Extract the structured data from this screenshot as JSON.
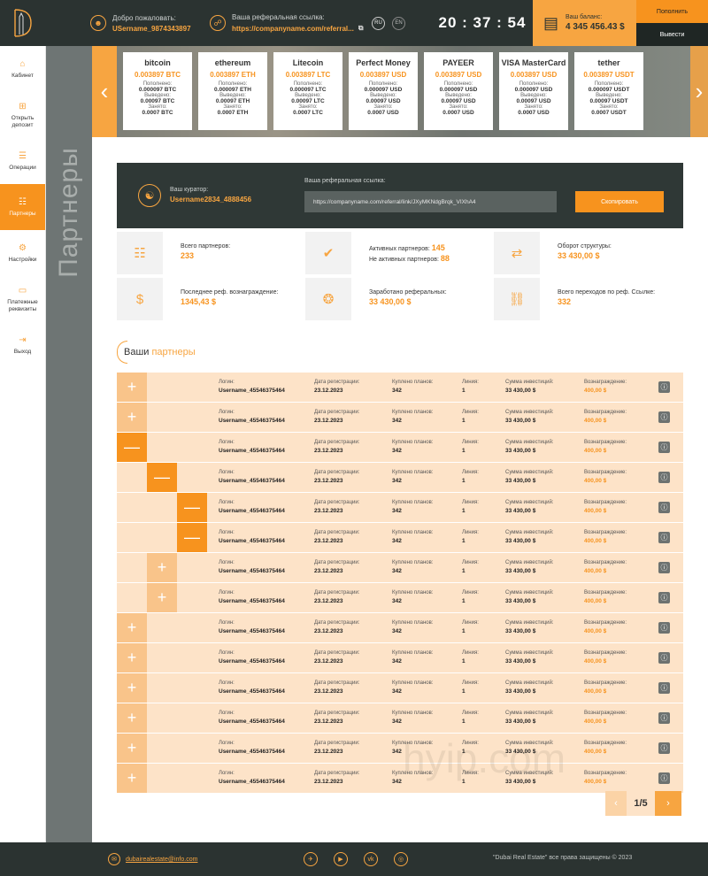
{
  "header": {
    "welcome_label": "Добро пожаловать:",
    "username": "USername_9874343897",
    "ref_label": "Ваша реферальная ссылка:",
    "ref_short": "https://companyname.com/referral...",
    "lang_ru": "RU",
    "lang_en": "EN",
    "clock": "20 : 37 : 54",
    "balance_label": "Ваш баланс:",
    "balance_value": "4 345 456.43 $",
    "deposit_button": "Пополнить",
    "withdraw_button": "Вывести"
  },
  "sidebar": [
    {
      "label": "Кабинет",
      "icon": "home-icon",
      "glyph": "⌂"
    },
    {
      "label": "Открыть депозит",
      "icon": "deposit-icon",
      "glyph": "⊞"
    },
    {
      "label": "Операции",
      "icon": "list-icon",
      "glyph": "☰"
    },
    {
      "label": "Партнеры",
      "icon": "partners-icon",
      "glyph": "☷",
      "active": true
    },
    {
      "label": "Настройки",
      "icon": "gear-icon",
      "glyph": "⚙"
    },
    {
      "label": "Платежные реквизиты",
      "icon": "wallet-icon",
      "glyph": "▭"
    },
    {
      "label": "Выход",
      "icon": "logout-icon",
      "glyph": "⇥"
    }
  ],
  "page_vertical_title": "Партнеры",
  "ticker": {
    "labels": {
      "replenished": "Пополнено:",
      "withdrawn": "Выведено:",
      "borrowed": "Занято:"
    },
    "coins": [
      {
        "name": "bitcoin",
        "rate": "0.003897 BTC",
        "replenished": "0.000097 BTC",
        "withdrawn": "0.00097 BTC",
        "borrowed": "0.0007 BTC"
      },
      {
        "name": "ethereum",
        "rate": "0.003897 ETH",
        "replenished": "0.000097 ETH",
        "withdrawn": "0.00097 ETH",
        "borrowed": "0.0007 ETH"
      },
      {
        "name": "Litecoin",
        "rate": "0.003897 LTC",
        "replenished": "0.000097 LTC",
        "withdrawn": "0.00097 LTC",
        "borrowed": "0.0007 LTC"
      },
      {
        "name": "Perfect Money",
        "rate": "0.003897 USD",
        "replenished": "0.000097 USD",
        "withdrawn": "0.00097 USD",
        "borrowed": "0.0007 USD"
      },
      {
        "name": "PAYEER",
        "rate": "0.003897 USD",
        "replenished": "0.000097 USD",
        "withdrawn": "0.00097 USD",
        "borrowed": "0.0007 USD"
      },
      {
        "name": "VISA MasterCard",
        "rate": "0.003897 USD",
        "replenished": "0.000097 USD",
        "withdrawn": "0.00097 USD",
        "borrowed": "0.0007 USD"
      },
      {
        "name": "tether",
        "rate": "0.003897 USDT",
        "replenished": "0.000097 USDT",
        "withdrawn": "0.00097 USDT",
        "borrowed": "0.0007 USDT"
      }
    ]
  },
  "referral": {
    "curator_label": "Ваш куратор:",
    "curator_value": "Username2834_4888456",
    "link_label": "Ваша реферальная ссылка:",
    "link_value": "https://companyname.com/referral/link/JXyMKNdgBrqk_VIXhA4",
    "copy_button": "Скопировать"
  },
  "stats": [
    {
      "label": "Всего партнеров:",
      "value": "233",
      "icon": "users-icon",
      "glyph": "☷"
    },
    {
      "label": "Активных партнеров:",
      "value": "145",
      "label2": "Не активных партнеров:",
      "value2": "88",
      "icon": "user-check-icon",
      "glyph": "✔"
    },
    {
      "label": "Оборот структуры:",
      "value": "33 430,00 $",
      "icon": "exchange-icon",
      "glyph": "⇄"
    },
    {
      "label": "Последнее реф. вознаграждение:",
      "value": "1345,43 $",
      "icon": "money-hand-icon",
      "glyph": "$"
    },
    {
      "label": "Заработано реферальных:",
      "value": "33 430,00 $",
      "icon": "coins-icon",
      "glyph": "❂"
    },
    {
      "label": "Всего переходов по реф. Ссылке:",
      "value": "332",
      "icon": "link-icon",
      "glyph": "⛓"
    }
  ],
  "partners": {
    "title_plain": "Ваши",
    "title_highlight": "партнеры",
    "headers": {
      "login": "Логин:",
      "date": "Дата регистрации:",
      "plans": "Куплено планов:",
      "line": "Линия:",
      "invest": "Сумма инвестиций:",
      "reward": "Вознаграждение:"
    },
    "rows": [
      {
        "level": 0,
        "state": "plus",
        "login": "Username_45546375464",
        "date": "23.12.2023",
        "plans": "342",
        "line": "1",
        "invest": "33 430,00 $",
        "reward": "400,00 $"
      },
      {
        "level": 0,
        "state": "plus",
        "login": "Username_45546375464",
        "date": "23.12.2023",
        "plans": "342",
        "line": "1",
        "invest": "33 430,00 $",
        "reward": "400,00 $"
      },
      {
        "level": 0,
        "state": "minus",
        "login": "Username_45546375464",
        "date": "23.12.2023",
        "plans": "342",
        "line": "1",
        "invest": "33 430,00 $",
        "reward": "400,00 $"
      },
      {
        "level": 1,
        "state": "minus",
        "login": "Username_45546375464",
        "date": "23.12.2023",
        "plans": "342",
        "line": "1",
        "invest": "33 430,00 $",
        "reward": "400,00 $"
      },
      {
        "level": 2,
        "state": "minus",
        "login": "Username_45546375464",
        "date": "23.12.2023",
        "plans": "342",
        "line": "1",
        "invest": "33 430,00 $",
        "reward": "400,00 $"
      },
      {
        "level": 2,
        "state": "minus",
        "login": "Username_45546375464",
        "date": "23.12.2023",
        "plans": "342",
        "line": "1",
        "invest": "33 430,00 $",
        "reward": "400,00 $"
      },
      {
        "level": 1,
        "state": "plus",
        "login": "Username_45546375464",
        "date": "23.12.2023",
        "plans": "342",
        "line": "1",
        "invest": "33 430,00 $",
        "reward": "400,00 $"
      },
      {
        "level": 1,
        "state": "plus",
        "login": "Username_45546375464",
        "date": "23.12.2023",
        "plans": "342",
        "line": "1",
        "invest": "33 430,00 $",
        "reward": "400,00 $"
      },
      {
        "level": 0,
        "state": "plus",
        "login": "Username_45546375464",
        "date": "23.12.2023",
        "plans": "342",
        "line": "1",
        "invest": "33 430,00 $",
        "reward": "400,00 $"
      },
      {
        "level": 0,
        "state": "plus",
        "login": "Username_45546375464",
        "date": "23.12.2023",
        "plans": "342",
        "line": "1",
        "invest": "33 430,00 $",
        "reward": "400,00 $"
      },
      {
        "level": 0,
        "state": "plus",
        "login": "Username_45546375464",
        "date": "23.12.2023",
        "plans": "342",
        "line": "1",
        "invest": "33 430,00 $",
        "reward": "400,00 $"
      },
      {
        "level": 0,
        "state": "plus",
        "login": "Username_45546375464",
        "date": "23.12.2023",
        "plans": "342",
        "line": "1",
        "invest": "33 430,00 $",
        "reward": "400,00 $"
      },
      {
        "level": 0,
        "state": "plus",
        "login": "Username_45546375464",
        "date": "23.12.2023",
        "plans": "342",
        "line": "1",
        "invest": "33 430,00 $",
        "reward": "400,00 $"
      },
      {
        "level": 0,
        "state": "plus",
        "login": "Username_45546375464",
        "date": "23.12.2023",
        "plans": "342",
        "line": "1",
        "invest": "33 430,00 $",
        "reward": "400,00 $"
      }
    ]
  },
  "pagination": {
    "current": "1/5"
  },
  "watermark": "hyip.com",
  "footer": {
    "email": "dubairealestate@info.com",
    "socials": [
      {
        "icon": "telegram-icon",
        "glyph": "✈"
      },
      {
        "icon": "youtube-icon",
        "glyph": "▶"
      },
      {
        "icon": "vk-icon",
        "glyph": "vk"
      },
      {
        "icon": "instagram-icon",
        "glyph": "◎"
      }
    ],
    "copyright": "\"Dubai Real Estate\" все права защищены © 2023"
  },
  "colors": {
    "accent": "#f7931e",
    "accent_light": "#f7a541",
    "row_bg": "#fde3c8",
    "dark": "#2b3331"
  }
}
